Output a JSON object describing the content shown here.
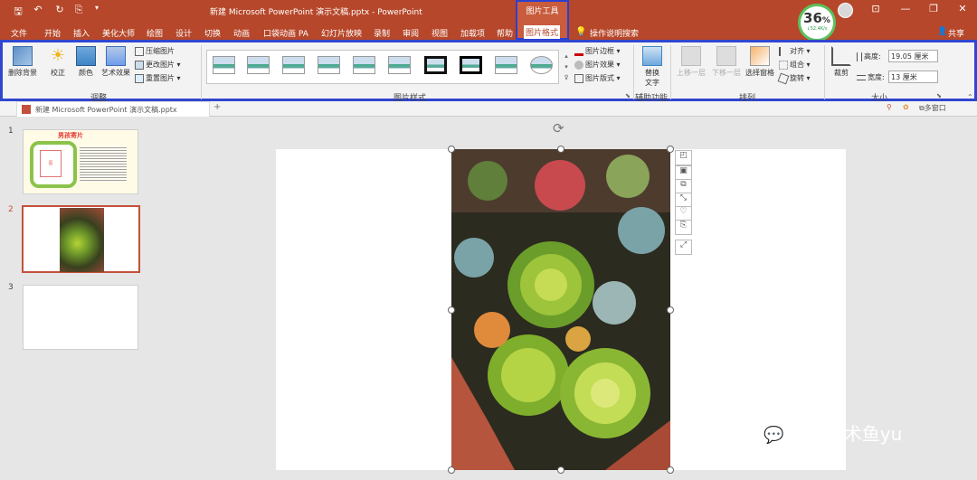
{
  "window": {
    "title": "新建 Microsoft PowerPoint 演示文稿.pptx  -  PowerPoint",
    "context_tab_group": "图片工具",
    "share_label": "共享"
  },
  "menu": {
    "items": [
      "文件",
      "开始",
      "插入",
      "美化大师",
      "绘图",
      "设计",
      "切换",
      "动画",
      "口袋动画 PA",
      "幻灯片放映",
      "录制",
      "审阅",
      "视图",
      "加载项",
      "帮助",
      "图片格式"
    ],
    "active": "图片格式",
    "tell_me": "操作说明搜索"
  },
  "net_monitor": {
    "percent": "36",
    "percent_sign": "%",
    "rate": "52.4K/s"
  },
  "ribbon": {
    "adjust": {
      "remove_bg": "删除背景",
      "correct": "校正",
      "color": "颜色",
      "artistic": "艺术效果",
      "compress": "压缩图片",
      "change": "更改图片",
      "reset": "重置图片",
      "group_label": "调整"
    },
    "styles": {
      "group_label": "图片样式",
      "border": "图片边框",
      "effects": "图片效果",
      "layout": "图片版式"
    },
    "accessibility": {
      "alt_text_1": "替换",
      "alt_text_2": "文字",
      "group_label": "辅助功能"
    },
    "arrange": {
      "bring_forward": "上移一层",
      "send_backward": "下移一层",
      "selection_pane": "选择窗格",
      "align": "对齐",
      "group": "组合",
      "rotate": "旋转",
      "group_label": "排列"
    },
    "size": {
      "crop": "裁剪",
      "height_label": "高度:",
      "height_value": "19.05 厘米",
      "width_label": "宽度:",
      "width_value": "13 厘米",
      "group_label": "大小"
    }
  },
  "doc_tab": {
    "name": "新建 Microsoft PowerPoint 演示文稿.pptx",
    "multi_window": "多窗口"
  },
  "slides": [
    {
      "number": "1",
      "title_text": "男孩寄片",
      "placeholder": "图"
    },
    {
      "number": "2"
    },
    {
      "number": "3"
    }
  ],
  "watermark": "信息技术鱼yu",
  "colors": {
    "titlebar": "#b7472a",
    "highlight_border": "#3146cf",
    "selected_slide": "#c4503b"
  }
}
